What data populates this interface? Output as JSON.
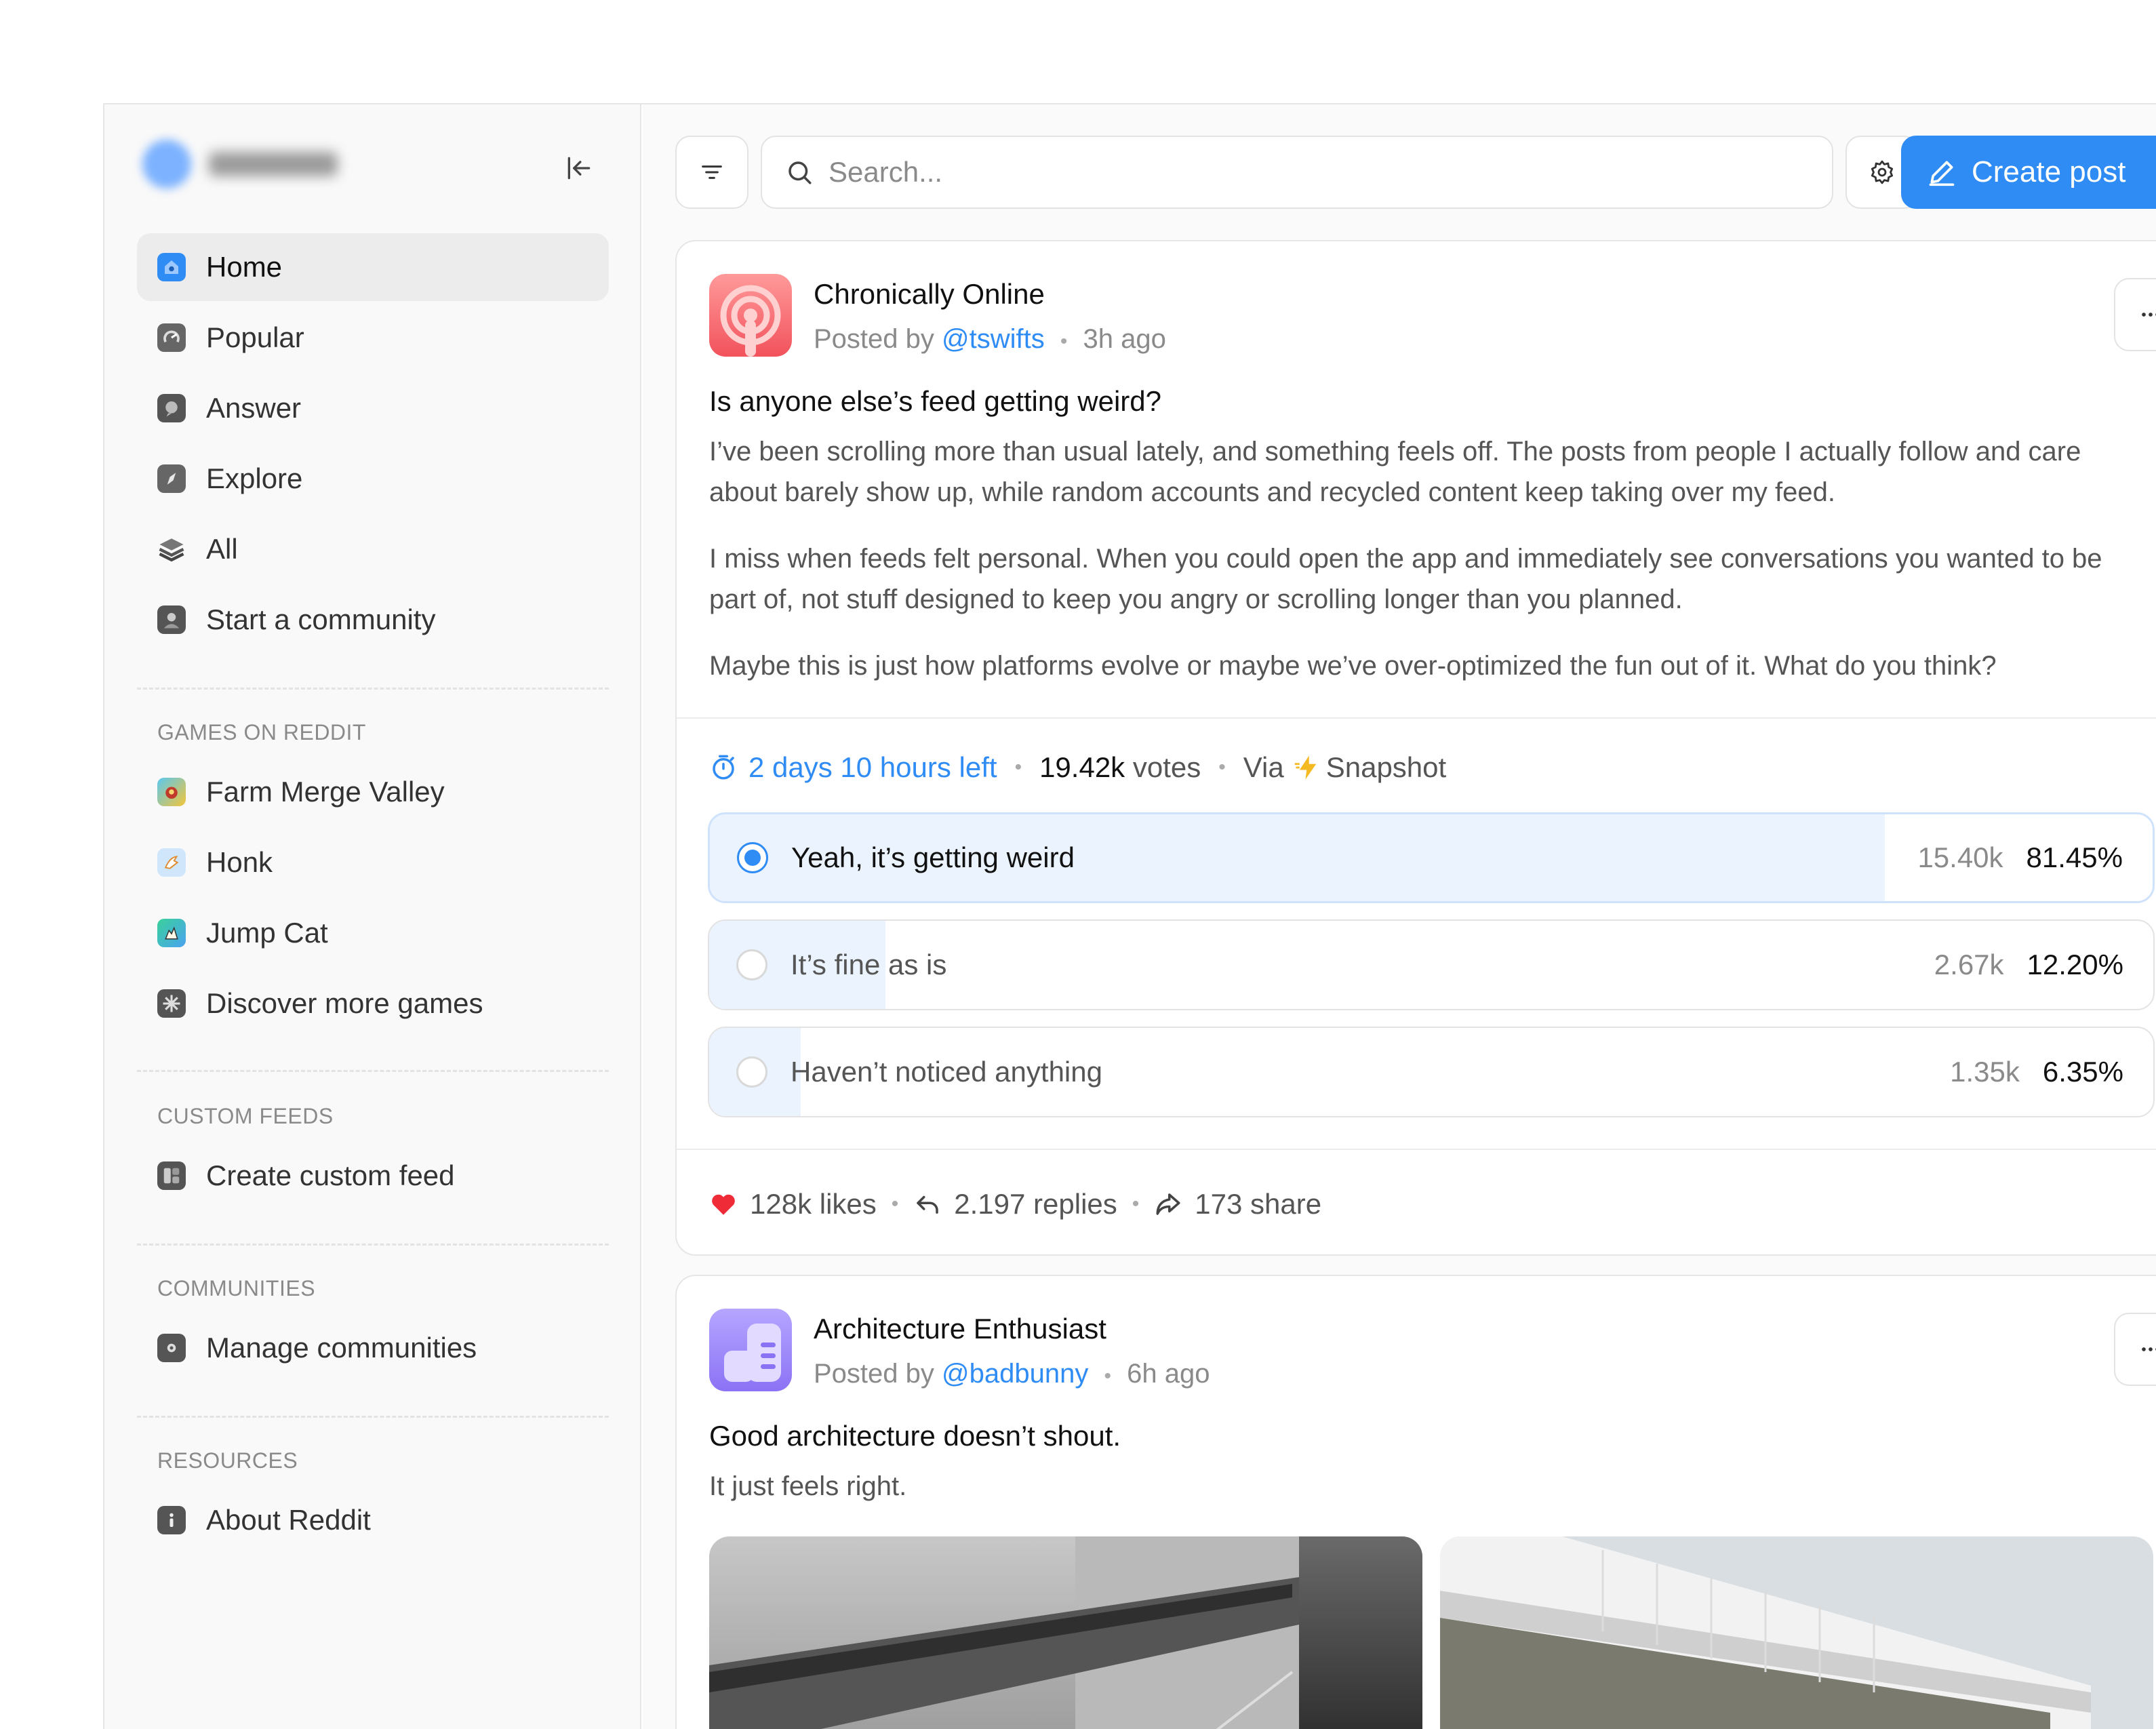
{
  "sidebar": {
    "nav": [
      {
        "label": "Home",
        "icon": "home-icon",
        "active": true
      },
      {
        "label": "Popular",
        "icon": "popular-icon"
      },
      {
        "label": "Answer",
        "icon": "answer-icon"
      },
      {
        "label": "Explore",
        "icon": "explore-icon"
      },
      {
        "label": "All",
        "icon": "all-icon"
      },
      {
        "label": "Start a community",
        "icon": "community-icon"
      }
    ],
    "games": {
      "title": "GAMES ON REDDIT",
      "items": [
        {
          "label": "Farm Merge Valley",
          "icon": "farm-merge-valley-icon"
        },
        {
          "label": "Honk",
          "icon": "honk-icon"
        },
        {
          "label": "Jump Cat",
          "icon": "jump-cat-icon"
        },
        {
          "label": "Discover more games",
          "icon": "discover-games-icon"
        }
      ]
    },
    "custom_feeds": {
      "title": "CUSTOM FEEDS",
      "items": [
        {
          "label": "Create custom feed",
          "icon": "custom-feed-icon"
        }
      ]
    },
    "communities": {
      "title": "COMMUNITIES",
      "items": [
        {
          "label": "Manage communities",
          "icon": "manage-communities-icon"
        }
      ]
    },
    "resources": {
      "title": "RESOURCES",
      "items": [
        {
          "label": "About Reddit",
          "icon": "info-icon"
        }
      ]
    }
  },
  "topbar": {
    "search_placeholder": "Search...",
    "create_label": "Create post"
  },
  "posts": [
    {
      "community": "Chronically Online",
      "posted_prefix": "Posted by",
      "user": "@tswifts",
      "time": "3h ago",
      "title": "Is anyone else’s feed getting weird?",
      "paragraphs": [
        "I’ve been scrolling more than usual lately, and something feels off. The posts from people I actually follow and care about barely show up, while random accounts and recycled content keep taking over my feed.",
        "I miss when feeds felt personal. When you could open the app and immediately see conversations you wanted to be part of, not stuff designed to keep you angry or scrolling longer than you planned.",
        "Maybe this is just how platforms evolve or maybe we’ve over-optimized the fun out of it. What do you think?"
      ],
      "poll": {
        "time_left": "2 days 10 hours left",
        "votes_number": "19.42k",
        "votes_word": "votes",
        "via": "Via",
        "via_app": "Snapshot",
        "options": [
          {
            "label": "Yeah, it’s getting weird",
            "count": "15.40k",
            "percent": "81.45%",
            "fraction": 0.8145,
            "selected": true
          },
          {
            "label": "It’s fine as is",
            "count": "2.67k",
            "percent": "12.20%",
            "fraction": 0.122,
            "selected": false
          },
          {
            "label": "Haven’t noticed anything",
            "count": "1.35k",
            "percent": "6.35%",
            "fraction": 0.0635,
            "selected": false
          }
        ]
      },
      "likes": "128k likes",
      "replies": "2.197 replies",
      "shares": "173 share"
    },
    {
      "community": "Architecture Enthusiast",
      "posted_prefix": "Posted by",
      "user": "@badbunny",
      "time": "6h ago",
      "title": "Good architecture doesn’t shout.",
      "body": "It just feels right."
    }
  ],
  "colors": {
    "accent": "#2f8cf5",
    "like": "#ef2b38",
    "poll_fill": "#eaf3fe"
  }
}
